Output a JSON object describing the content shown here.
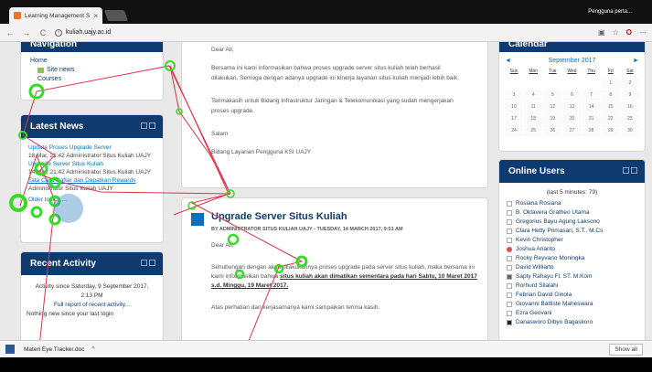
{
  "browser": {
    "tab_title": "Learning Management S",
    "url": "kuliah.uajy.ac.id",
    "profile": "Pengguna perta..."
  },
  "navigation": {
    "title": "Navigation",
    "home": "Home",
    "site_news": "Site news",
    "courses": "Courses"
  },
  "latest_news": {
    "title": "Latest News",
    "items": [
      {
        "link": "Update Proses Upgrade Server",
        "meta": "18 Mar, 21:42 Administrator Situs Kuliah UAJY"
      },
      {
        "link": "Upgrade Server Situs Kuliah",
        "meta": "14 Mar, 21:42 Administrator Situs Kuliah UAJY"
      },
      {
        "link": "Tata Cara Daftar dan Dapatkan Rewards",
        "meta": "Administrator Situs Kuliah UAJY"
      }
    ],
    "older": "Older topics ..."
  },
  "recent_activity": {
    "title": "Recent Activity",
    "since": "Activity since Saturday, 9 September 2017,",
    "time": "2:13 PM",
    "full_report": "Full report of recent activity...",
    "nothing": "Nothing new since your last login"
  },
  "post1": {
    "greeting": "Dear All,",
    "para1": "Bersama ini kami informasikan bahwa proses upgrade server situs kuliah telah berhasil dilakukan. Semoga dengan adanya upgrade ini kinerja layanan situs kuliah menjadi lebih baik",
    "para2": "Terimakasih untuk Bidang Infrastruktur Jaringan & Telekomunikasi yang sudah mengerjakan proses upgrade.",
    "salam": "Salam",
    "signoff": "Bidang Layanan Pengguna KSI UAJY"
  },
  "post2": {
    "title": "Upgrade Server Situs Kuliah",
    "meta": "BY ADMINISTRATOR SITUS KULIAH UAJY - TUESDAY, 14 MARCH 2017, 9:51 AM",
    "greeting": "Dear All,",
    "para1": "Sehubungan dengan akan dilakukannya proses upgrade pada server situs kuliah, maka bersama ini kami informasikan bahwa",
    "para1_bold": "situs kuliah akan dimatikan sementara pada hari Sabtu, 10 Maret 2017 s.d. Minggu, 19 Maret 2017.",
    "para2": "Atas perhatian dan kerjasamanya kami sampaikan terima kasih."
  },
  "calendar": {
    "title": "Calendar",
    "month": "September 2017",
    "prev": "◄",
    "next": "►",
    "days": [
      "Sun",
      "Mon",
      "Tue",
      "Wed",
      "Thu",
      "Fri",
      "Sat"
    ],
    "weeks": [
      [
        "",
        "",
        "",
        "",
        "",
        "1",
        "2"
      ],
      [
        "3",
        "4",
        "5",
        "6",
        "7",
        "8",
        "9"
      ],
      [
        "10",
        "11",
        "12",
        "13",
        "14",
        "15",
        "16"
      ],
      [
        "17",
        "18",
        "19",
        "20",
        "21",
        "22",
        "23"
      ],
      [
        "24",
        "25",
        "26",
        "27",
        "28",
        "29",
        "30"
      ]
    ]
  },
  "online_users": {
    "title": "Online Users",
    "period": "(last 5 minutes: 79)",
    "users": [
      "Rosiana Rosiana",
      "B. Oktavera Gratheo Utama",
      "Gregorius Bayu Agung Laksono",
      "Clara Hetty Primasari, S.T., M.Cs",
      "Kevin Christopher",
      "Joshua Arianto",
      "Rocky Reyvano Moningka",
      "David Williarto",
      "Sapty Rahayu Fl. ST. M.Kom",
      "Rorhurd Silalahi",
      "Febrian David Ginola",
      "Giovanni Battiste Maheswara",
      "Ezra Geovani",
      "Danasworo Dibyo Bagaskoro"
    ]
  },
  "download": {
    "file": "Materi Eye Tracker.doc",
    "show_all": "Show all"
  },
  "colors": {
    "brand": "#0e3a6f",
    "gaze_fixation": "#33dd22",
    "gaze_path": "#e0334a"
  }
}
